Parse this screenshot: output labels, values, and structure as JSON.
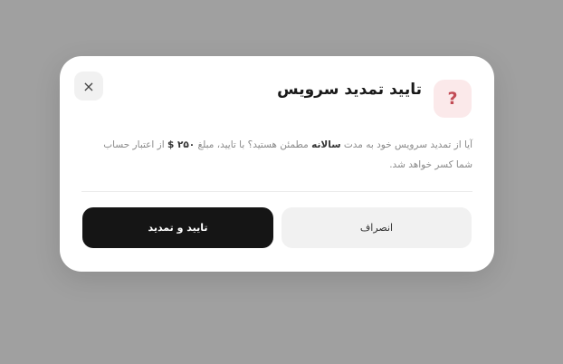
{
  "dialog": {
    "icon": {
      "name": "question-icon",
      "glyph": "?"
    },
    "title": "تایید تمدید سرویس",
    "close_glyph": "×",
    "message": {
      "part1": "آیا از تمدید سرویس خود به مدت ",
      "period": "سالانه",
      "part2": " مطمئن هستید؟ با تایید، مبلغ ",
      "amount": "۲۵۰ $",
      "part3": " از اعتبار حساب شما کسر خواهد شد."
    },
    "cancel_label": "انصراف",
    "confirm_label": "تایید و تمدید"
  },
  "colors": {
    "overlay": "#a0a0a0",
    "dialog_bg": "#ffffff",
    "icon_bg": "#fbe9ea",
    "icon_fg": "#c24b55",
    "confirm_bg": "#151515",
    "cancel_bg": "#f1f1f1"
  }
}
